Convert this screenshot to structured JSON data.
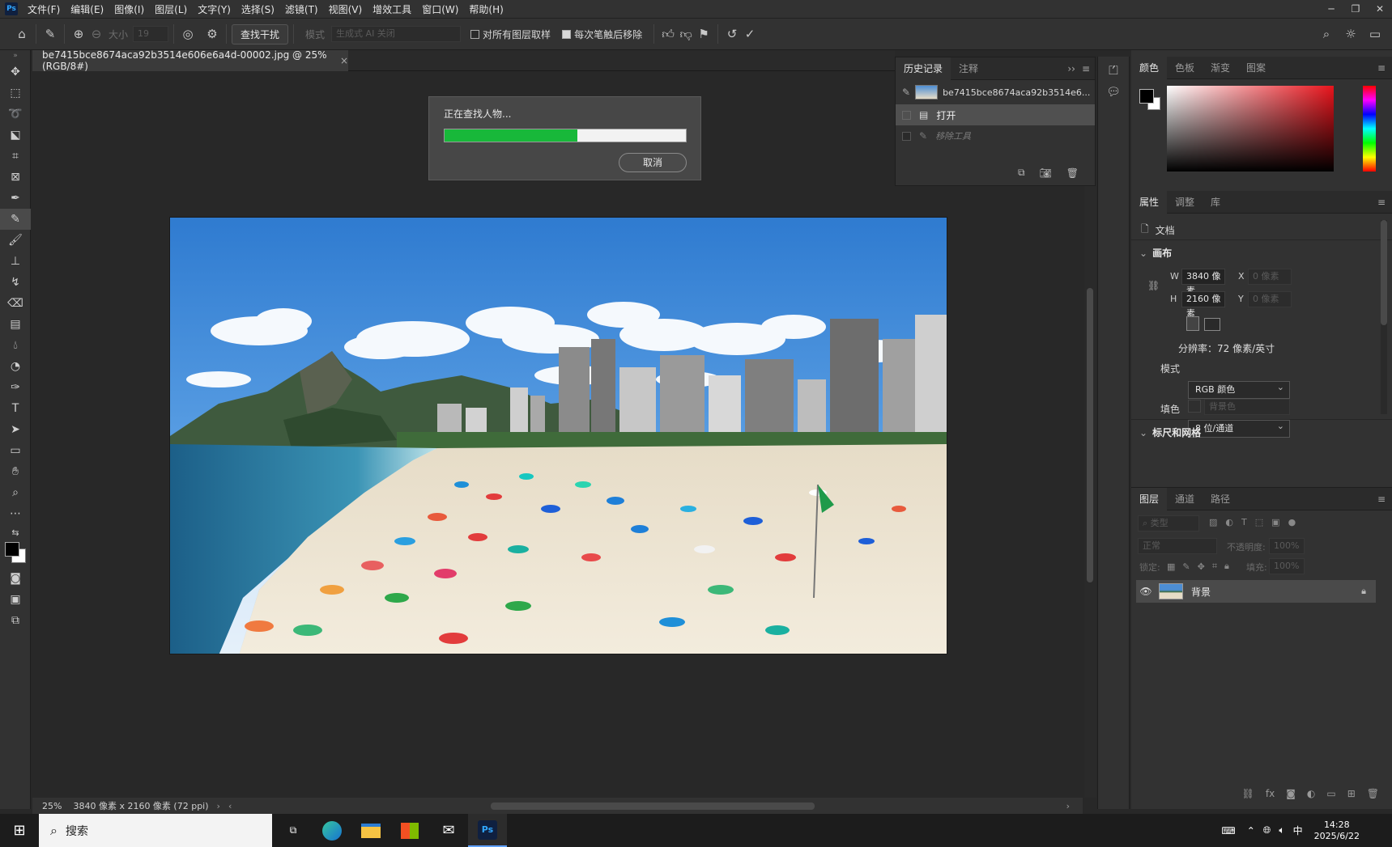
{
  "app": {
    "logo": "Ps"
  },
  "menu": [
    "文件(F)",
    "编辑(E)",
    "图像(I)",
    "图层(L)",
    "文字(Y)",
    "选择(S)",
    "滤镜(T)",
    "视图(V)",
    "增效工具",
    "窗口(W)",
    "帮助(H)"
  ],
  "options": {
    "size_label": "大小",
    "size_value": "19",
    "find_button": "查找干扰",
    "mode_label": "模式",
    "mode_value": "生成式 AI 关闭",
    "sample_all_label": "对所有图层取样",
    "remove_after_label": "每次笔触后移除",
    "sample_all_checked": false,
    "remove_after_checked": true
  },
  "document": {
    "tab_title": "be7415bce8674aca92b3514e606e6a4d-00002.jpg @ 25%(RGB/8#)",
    "close": "×"
  },
  "dialog": {
    "message": "正在查找人物...",
    "progress": 0.55,
    "cancel_label": "取消"
  },
  "history": {
    "tabs": [
      "历史记录",
      "注释"
    ],
    "snapshot_name": "be7415bce8674aca92b3514e6...",
    "items": [
      {
        "label": "打开",
        "selected": true
      },
      {
        "label": "移除工具",
        "selected": false
      }
    ]
  },
  "color_panel": {
    "tabs": [
      "颜色",
      "色板",
      "渐变",
      "图案"
    ],
    "hue_color": "#e8141c"
  },
  "properties": {
    "tabs": [
      "属性",
      "调整",
      "库"
    ],
    "doc_label": "文档",
    "canvas_section": "画布",
    "w_label": "W",
    "w_value": "3840 像素",
    "h_label": "H",
    "h_value": "2160 像素",
    "x_label": "X",
    "x_value": "0 像素",
    "y_label": "Y",
    "y_value": "0 像素",
    "resolution": "分辨率：72 像素/英寸",
    "mode_label": "模式",
    "mode_value": "RGB 颜色",
    "depth_value": "8 位/通道",
    "fill_label": "填色",
    "fill_value": "背景色",
    "rulers_section": "标尺和网格"
  },
  "layers": {
    "tabs": [
      "图层",
      "通道",
      "路径"
    ],
    "filter_placeholder": "类型",
    "blend_mode": "正常",
    "opacity_label": "不透明度:",
    "opacity_value": "100%",
    "lock_label": "锁定:",
    "fill_label": "填充:",
    "fill_value": "100%",
    "layer_name": "背景"
  },
  "status": {
    "zoom": "25%",
    "info": "3840 像素 x 2160 像素 (72 ppi)"
  },
  "taskbar": {
    "search_placeholder": "搜索",
    "ime": "中",
    "time": "14:28",
    "date": "2025/6/22"
  }
}
